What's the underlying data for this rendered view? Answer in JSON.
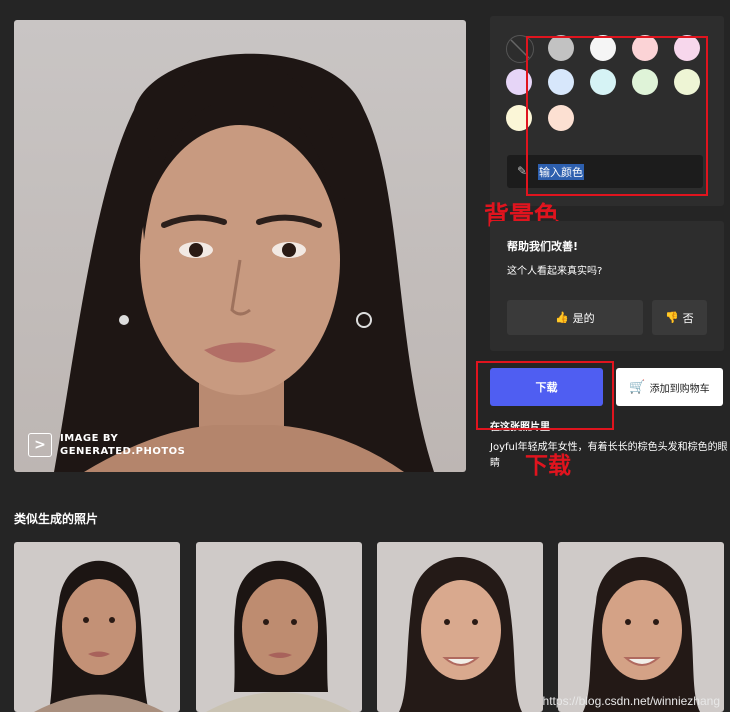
{
  "watermark": {
    "logo": ">",
    "line1": "IMAGE BY",
    "line2": "GENERATED.PHOTOS"
  },
  "background_panel": {
    "no_color_icon": "no-color-slash-icon",
    "swatches": [
      "#c2c2c2",
      "#f5f5f5",
      "#fbd3d6",
      "#f7d7ec",
      "#e6d5f7",
      "#d7e7fb",
      "#d6f3f5",
      "#dff3d8",
      "#eef5d5",
      "#fbf6d7",
      "#fce0d2"
    ],
    "input_placeholder": "输入颜色",
    "annotation": "背景色",
    "annotation_color": "#e0141e"
  },
  "feedback": {
    "title": "帮助我们改善!",
    "question": "这个人看起来真实吗?",
    "yes_label": "是的",
    "no_label": "否"
  },
  "actions": {
    "download_label": "下载",
    "download_color": "#4f5ef2",
    "cart_label": "添加到购物车",
    "annotation": "下载"
  },
  "description": {
    "heading": "在这张照片里",
    "text": "Joyful年轻成年女性，有着长长的棕色头发和棕色的眼睛"
  },
  "similar": {
    "title": "类似生成的照片"
  },
  "credit": "https://blog.csdn.net/winniezhang"
}
